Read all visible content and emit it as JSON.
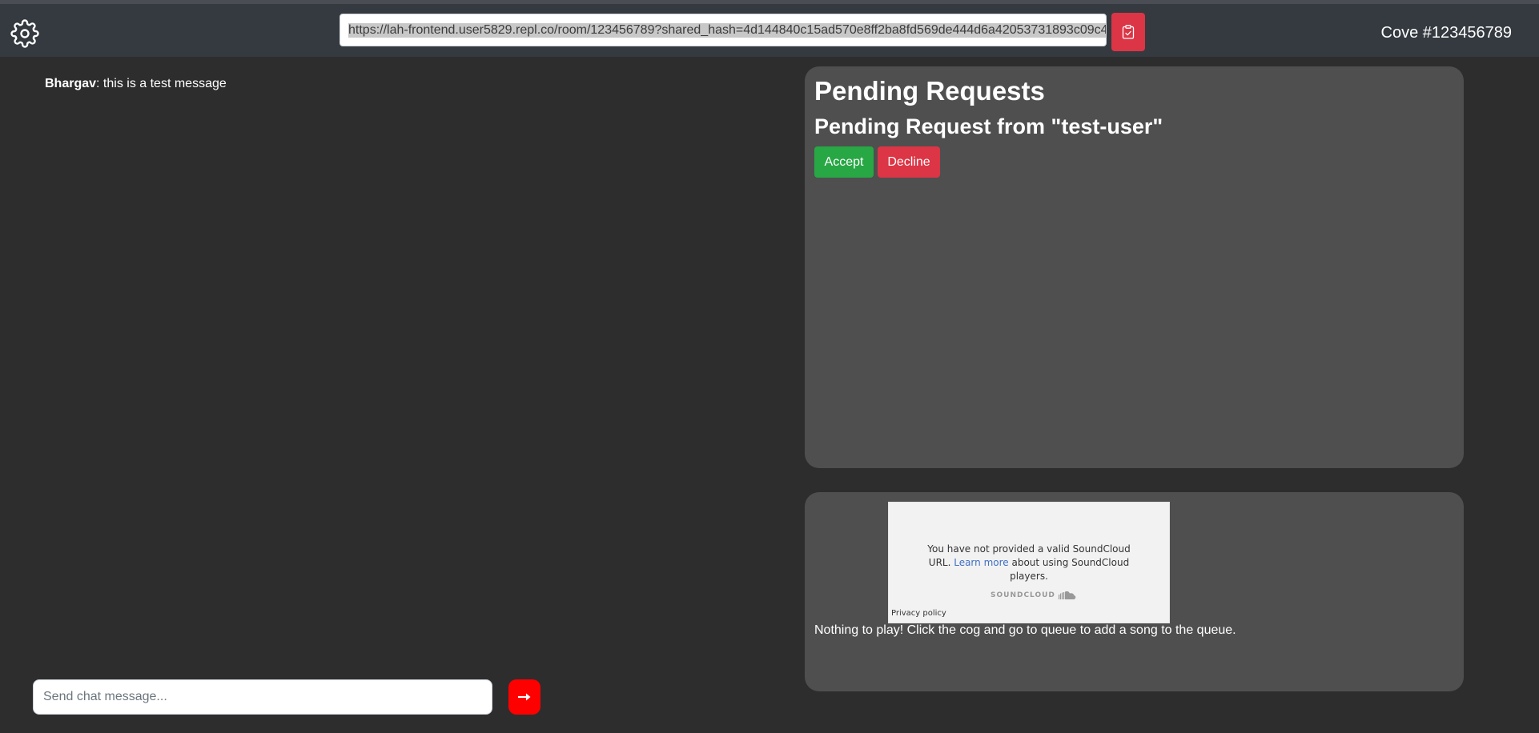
{
  "navbar": {
    "share_url": "https://lah-frontend.user5829.repl.co/room/123456789?shared_hash=4d144840c15ad570e8ff2ba8fd569de444d6a42053731893c09c4",
    "room_name": "Cove #123456789",
    "settings_icon": "gear-icon",
    "copy_icon": "clipboard-icon",
    "copy_button_color": "#dc3545"
  },
  "chat": {
    "messages": [
      {
        "author": "Bhargav",
        "text": ": this is a test message"
      }
    ],
    "input_placeholder": "Send chat message...",
    "input_value": "",
    "send_icon": "arrow-right-icon",
    "send_button_color": "#ff0000"
  },
  "requests": {
    "heading": "Pending Requests",
    "items": [
      {
        "title": "Pending Request from \"test-user\"",
        "accept_label": "Accept",
        "decline_label": "Decline"
      }
    ],
    "accept_color": "#28a745",
    "decline_color": "#dc3545"
  },
  "player": {
    "widget": {
      "message_before_link": "You have not provided a valid SoundCloud URL. ",
      "link_text": "Learn more",
      "message_after_link": " about using SoundCloud players.",
      "logo_text": "SOUNDCLOUD",
      "privacy_label": "Privacy policy"
    },
    "empty_message": "Nothing to play! Click the cog and go to queue to add a song to the queue."
  }
}
